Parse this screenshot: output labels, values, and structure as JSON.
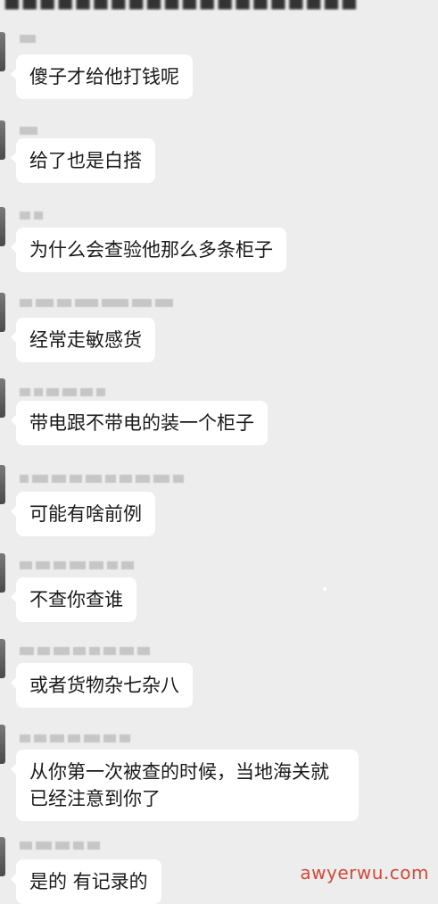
{
  "messages": [
    {
      "text": "傻子才给他打钱呢"
    },
    {
      "text": "给了也是白搭"
    },
    {
      "text": "为什么会查验他那么多条柜子"
    },
    {
      "text": "经常走敏感货"
    },
    {
      "text": "带电跟不带电的装一个柜子"
    },
    {
      "text": "可能有啥前例"
    },
    {
      "text": "不查你查谁"
    },
    {
      "text": "或者货物杂七杂八"
    },
    {
      "text": "从你第一次被查的时候，当地海关就已经注意到你了"
    },
    {
      "text": "是的 有记录的"
    }
  ],
  "watermark": "awyerwu.com"
}
